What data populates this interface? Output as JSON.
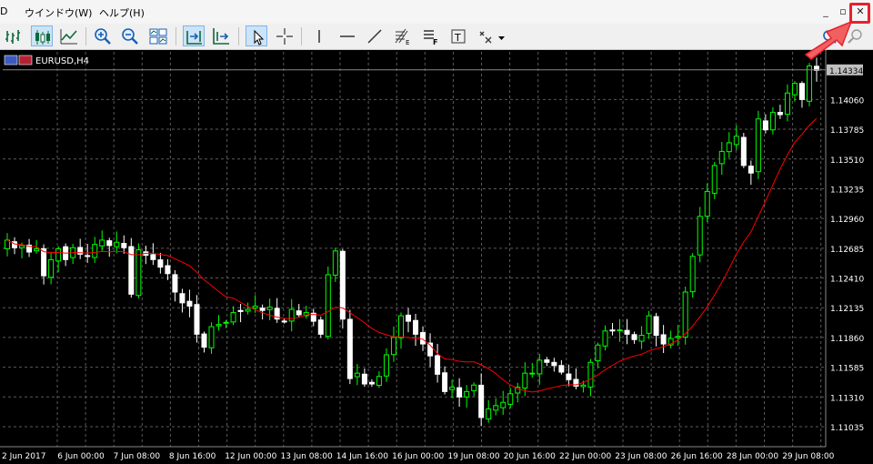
{
  "menu": {
    "item_partial": "D",
    "window": "ウインドウ(W)",
    "help": "ヘルプ(H)"
  },
  "window_controls": {
    "minimize": "_",
    "restore": "▫",
    "close": "✕"
  },
  "toolbar_icons": [
    "bar-chart-icon",
    "candlestick-icon",
    "line-chart-icon",
    "zoom-in-icon",
    "zoom-out-icon",
    "tile-windows-icon",
    "chart-shift-icon",
    "autoscroll-icon",
    "cursor-icon",
    "crosshair-icon",
    "vertical-line-icon",
    "horizontal-line-icon",
    "trendline-icon",
    "fibonacci-icon",
    "text-label-icon",
    "text-box-icon",
    "arrows-icon",
    "search-icon",
    "help-icon"
  ],
  "chart": {
    "symbol_label": "EURUSD,H4",
    "current_price_label": "1.14334",
    "colors": {
      "background": "#000000",
      "bull": "#00ff00",
      "bear": "#ffffff",
      "ma": "#ff0000",
      "grid": "#5a5a5a",
      "text": "#ffffff"
    }
  },
  "chart_data": {
    "type": "candlestick",
    "title": "EURUSD,H4",
    "y_ticks": [
      "1.14060",
      "1.13785",
      "1.13510",
      "1.13235",
      "1.12960",
      "1.12685",
      "1.12410",
      "1.12135",
      "1.11860",
      "1.11585",
      "1.11310",
      "1.11035"
    ],
    "ylim": [
      1.1085,
      1.1445
    ],
    "x_ticks": [
      "2 Jun 2017",
      "6 Jun 00:00",
      "7 Jun 08:00",
      "8 Jun 16:00",
      "12 Jun 00:00",
      "13 Jun 08:00",
      "14 Jun 16:00",
      "16 Jun 00:00",
      "19 Jun 08:00",
      "20 Jun 16:00",
      "22 Jun 00:00",
      "23 Jun 08:00",
      "26 Jun 16:00",
      "28 Jun 00:00",
      "29 Jun 08:00"
    ],
    "closes": [
      1.1276,
      1.1269,
      1.1271,
      1.1265,
      1.1268,
      1.1243,
      1.1258,
      1.1268,
      1.1258,
      1.1269,
      1.1263,
      1.1261,
      1.1272,
      1.1276,
      1.1271,
      1.1274,
      1.1269,
      1.1226,
      1.1267,
      1.1262,
      1.1258,
      1.1251,
      1.1245,
      1.1228,
      1.1218,
      1.1215,
      1.1189,
      1.1177,
      1.1196,
      1.1198,
      1.12,
      1.1209,
      1.121,
      1.1212,
      1.1215,
      1.1211,
      1.1214,
      1.1203,
      1.1201,
      1.1212,
      1.1207,
      1.1209,
      1.1201,
      1.1189,
      1.1244,
      1.1266,
      1.1203,
      1.1148,
      1.1153,
      1.1143,
      1.1143,
      1.115,
      1.117,
      1.1186,
      1.1206,
      1.1201,
      1.1189,
      1.118,
      1.1169,
      1.1152,
      1.1136,
      1.114,
      1.1131,
      1.1136,
      1.1142,
      1.1112,
      1.112,
      1.1123,
      1.1126,
      1.1134,
      1.114,
      1.1153,
      1.1153,
      1.1165,
      1.1163,
      1.116,
      1.1154,
      1.1147,
      1.1141,
      1.1142,
      1.1163,
      1.1179,
      1.1192,
      1.1192,
      1.1193,
      1.1189,
      1.1184,
      1.1188,
      1.1206,
      1.1188,
      1.118,
      1.1185,
      1.1187,
      1.1228,
      1.1261,
      1.1298,
      1.1321,
      1.1345,
      1.1358,
      1.1366,
      1.1372,
      1.1345,
      1.1338,
      1.1388,
      1.1378,
      1.1394,
      1.1392,
      1.1412,
      1.1421,
      1.1406,
      1.1437,
      1.1433
    ]
  }
}
